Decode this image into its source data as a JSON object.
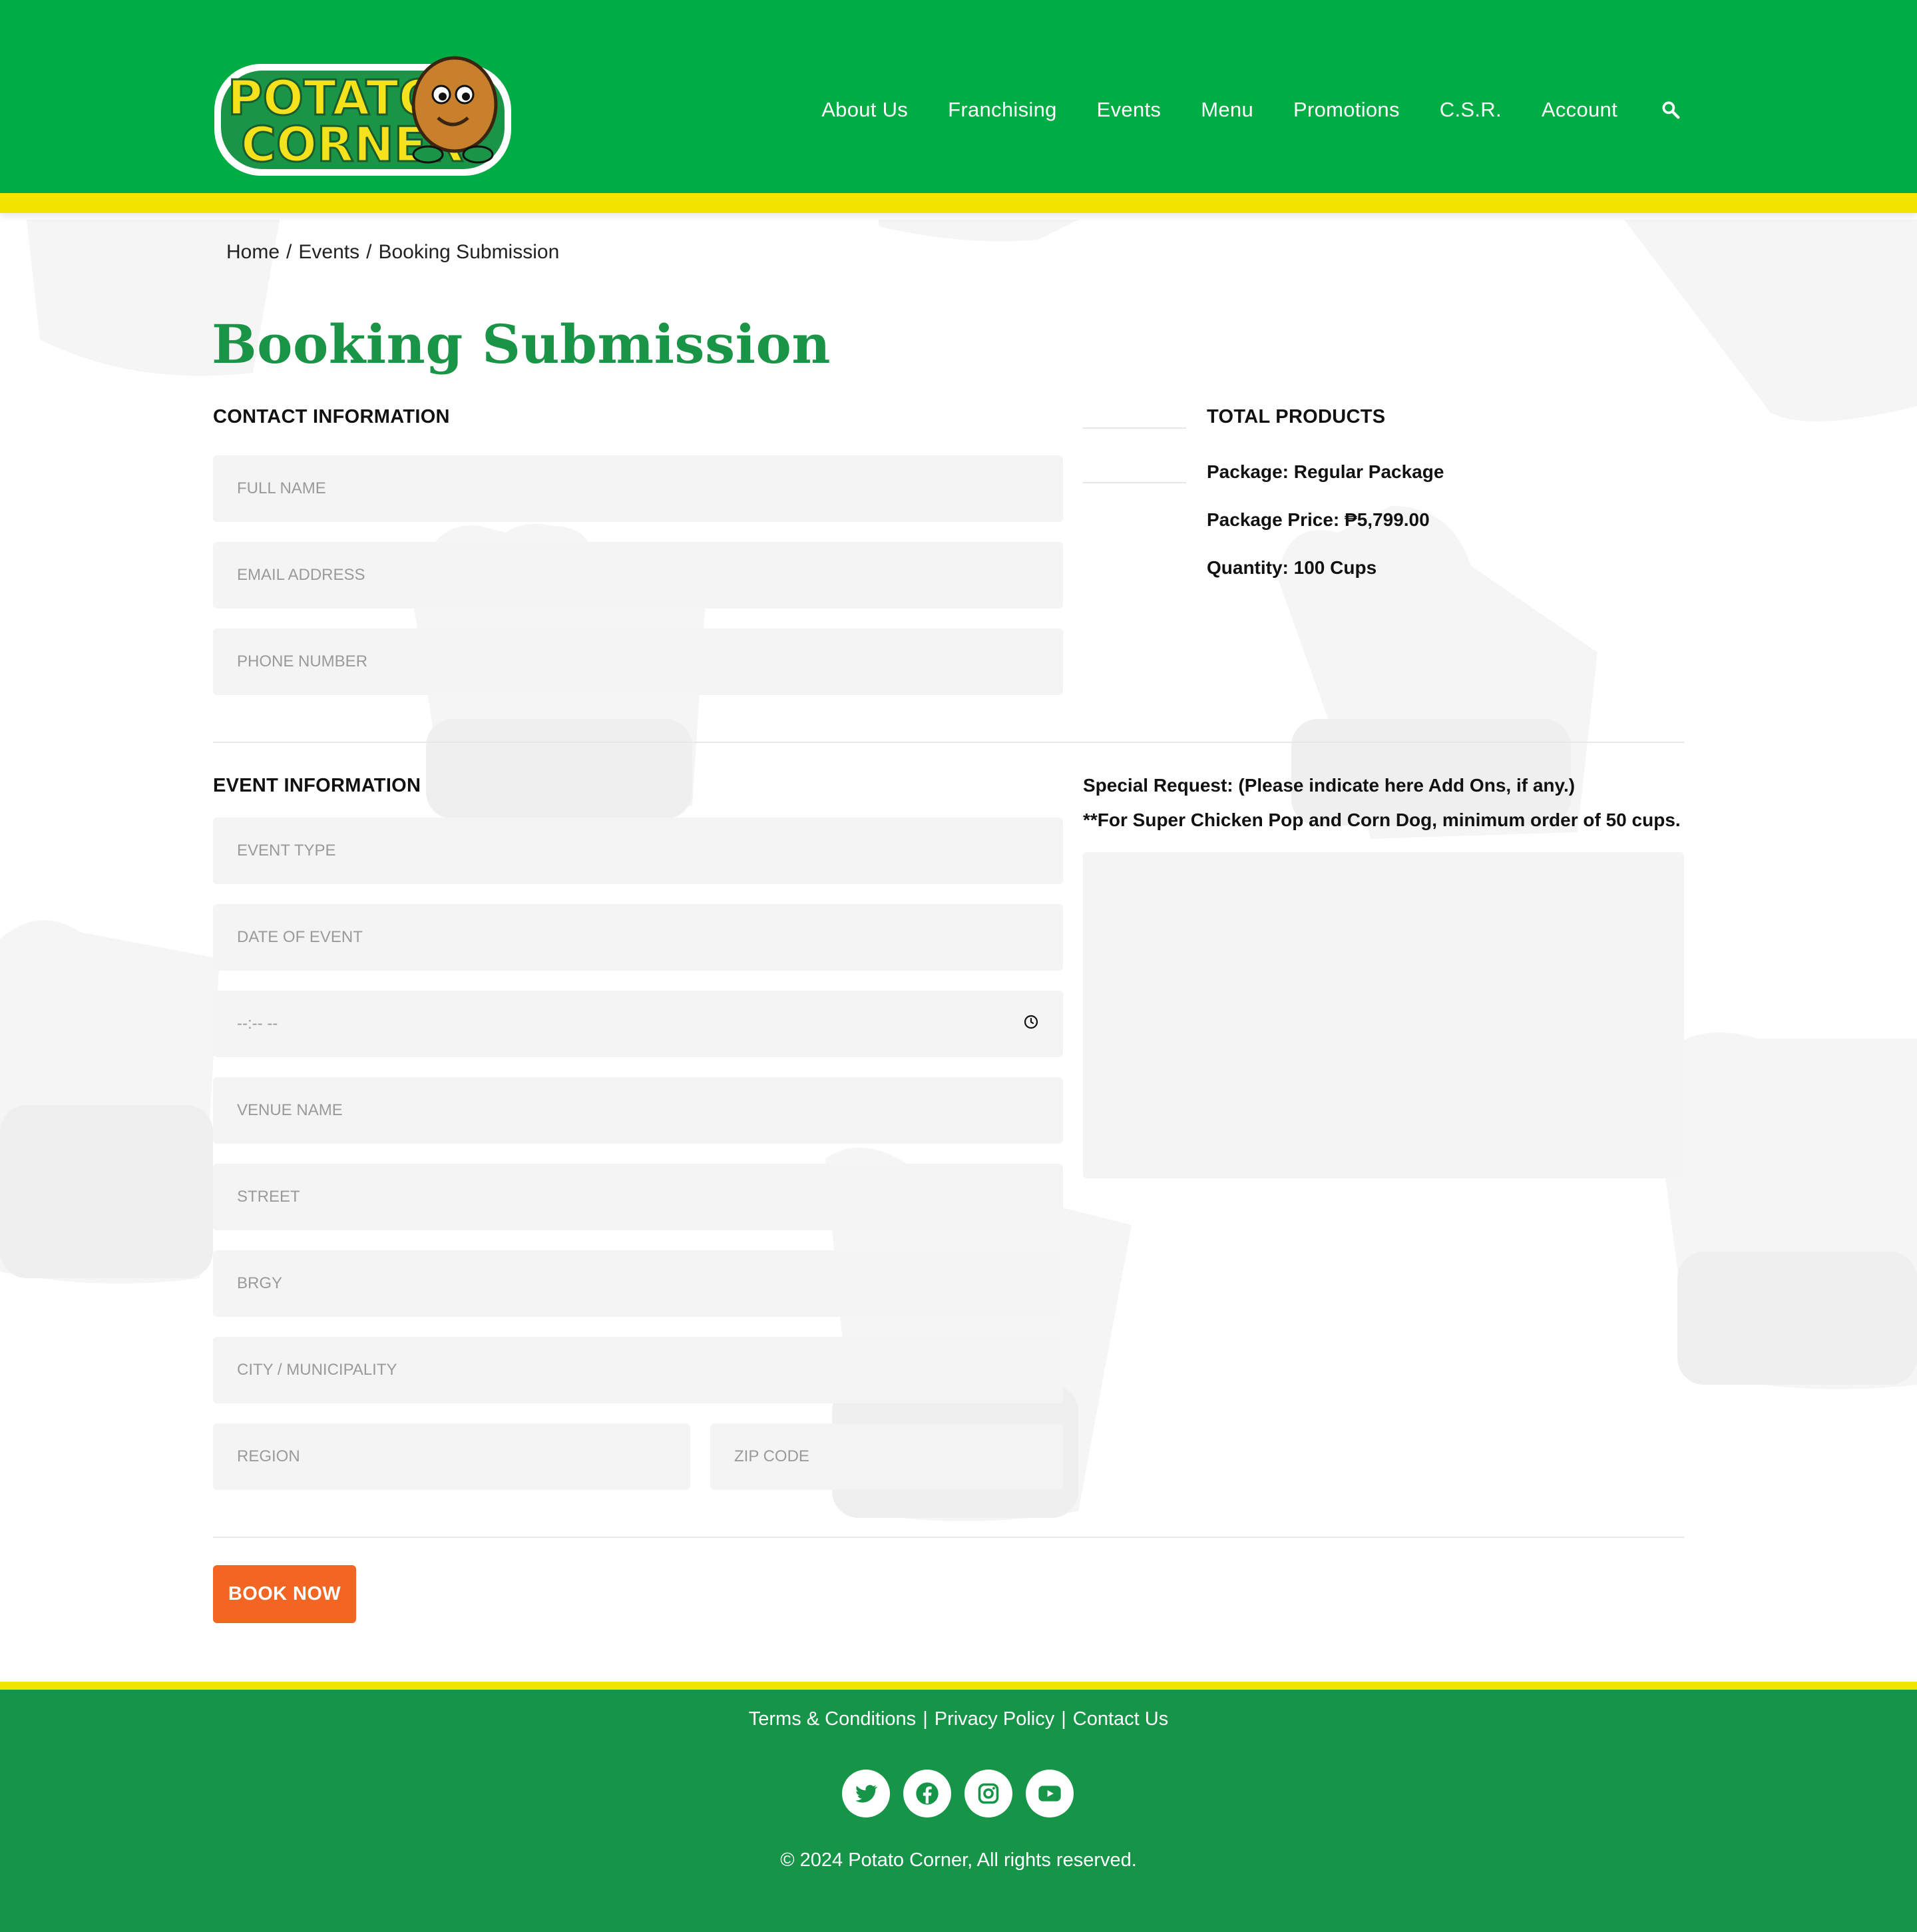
{
  "header": {
    "logo_text_line1": "POTATO",
    "logo_text_line2": "CORNER",
    "nav": [
      "About Us",
      "Franchising",
      "Events",
      "Menu",
      "Promotions",
      "C.S.R.",
      "Account"
    ],
    "search_icon": "search-icon"
  },
  "breadcrumb": {
    "home": "Home",
    "events": "Events",
    "current": "Booking Submission",
    "separator": "/"
  },
  "page_title": "Booking Submission",
  "contact": {
    "heading": "CONTACT INFORMATION",
    "full_name_placeholder": "FULL NAME",
    "email_placeholder": "EMAIL ADDRESS",
    "phone_placeholder": "PHONE NUMBER"
  },
  "summary": {
    "heading": "TOTAL PRODUCTS",
    "package": "Package: Regular Package",
    "price": "Package Price: ₱5,799.00",
    "quantity": "Quantity: 100 Cups"
  },
  "event": {
    "heading": "EVENT INFORMATION",
    "event_type_placeholder": "EVENT TYPE",
    "date_placeholder": "DATE OF EVENT",
    "time_value": "--:-- --",
    "venue_placeholder": "VENUE NAME",
    "street_placeholder": "STREET",
    "brgy_placeholder": "BRGY",
    "city_placeholder": "CITY / MUNICIPALITY",
    "region_placeholder": "REGION",
    "zip_placeholder": "ZIP CODE"
  },
  "special_request": {
    "label": "Special Request: (Please indicate here Add Ons, if any.)",
    "note": "**For Super Chicken Pop and Corn Dog, minimum order of 50 cups."
  },
  "book_button": "BOOK NOW",
  "footer": {
    "terms": "Terms & Conditions",
    "privacy": "Privacy Policy",
    "contact": "Contact Us",
    "separator": "|",
    "socials": [
      "twitter-icon",
      "facebook-icon",
      "instagram-icon",
      "youtube-icon"
    ],
    "copyright": "© 2024 Potato Corner, All rights reserved."
  },
  "colors": {
    "header_green": "#00ac44",
    "footer_green": "#169448",
    "accent_yellow": "#f3e500",
    "title_green": "#1a9446",
    "button_orange": "#f26522",
    "field_bg": "#f4f4f4"
  }
}
